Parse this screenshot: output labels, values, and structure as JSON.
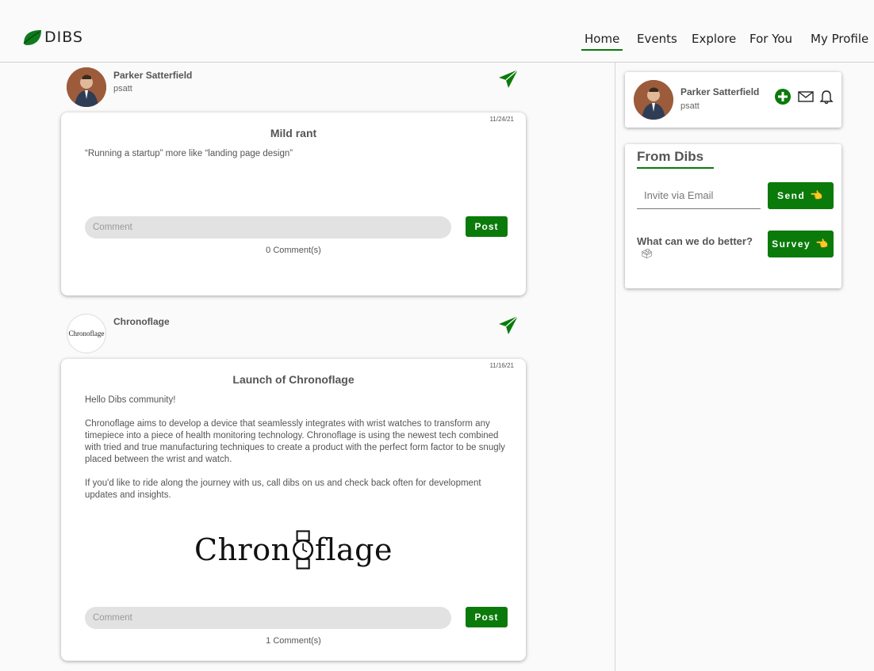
{
  "brand": {
    "name": "DIBS"
  },
  "nav": {
    "items": [
      "Home",
      "Events",
      "Explore",
      "For You",
      "My Profile"
    ],
    "active": "Home"
  },
  "feed": [
    {
      "author": "Parker Satterfield",
      "handle": "psatt",
      "date": "11/24/21",
      "title": "Mild rant",
      "body": [
        "“Running a startup” more like “landing page design”"
      ],
      "comment_placeholder": "Comment",
      "post_label": "Post",
      "comment_count": "0 Comment(s)"
    },
    {
      "author": "Chronoflage",
      "handle": "",
      "avatar_text": "Chronoflage",
      "date": "11/16/21",
      "title": "Launch of Chronoflage",
      "body": [
        "Hello Dibs community!",
        "Chronoflage aims to develop a device that seamlessly integrates with wrist watches to transform any timepiece into a piece of health monitoring technology. Chronoflage is using the newest tech combined with tried and true manufacturing techniques to create a product with the perfect form factor to be snugly placed between the wrist and watch.",
        "If you'd like to ride along the journey with us, call dibs on us and check back often for development updates and insights."
      ],
      "image_logo_left": "Chron",
      "image_logo_right": "flage",
      "comment_placeholder": "Comment",
      "post_label": "Post",
      "comment_count": "1 Comment(s)"
    }
  ],
  "sidebar": {
    "profile": {
      "name": "Parker Satterfield",
      "handle": "psatt"
    },
    "from_dibs": {
      "title": "From Dibs",
      "email_placeholder": "Invite via Email",
      "send_label": "Send",
      "question": "What can we do better?",
      "survey_label": "Survey"
    }
  },
  "colors": {
    "accent": "#0a7a0a",
    "background": "#fafafa"
  }
}
